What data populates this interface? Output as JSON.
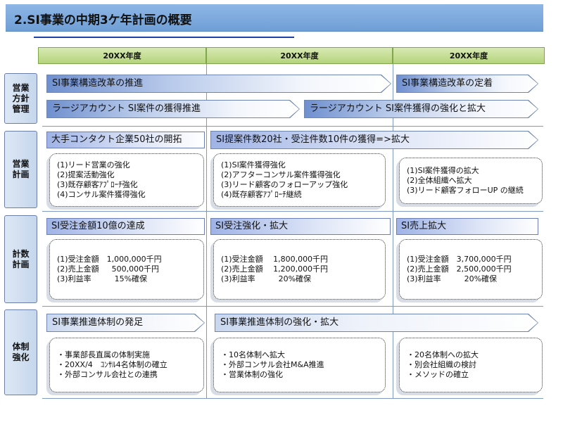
{
  "header": {
    "title": "2.SI事業の中期3ケ年計画の概要"
  },
  "columns": [
    "20XX年度",
    "20XX年度",
    "20XX年度"
  ],
  "rows": {
    "sales_policy": {
      "label": "営業\n方針\n管理",
      "arrows": [
        "SI事業構造改革の推進",
        "SI事業構造改革の定着",
        "ラージアカウント SI案件の獲得推進",
        "ラージアカウント SI案件獲得の強化と拡大"
      ]
    },
    "sales_plan": {
      "label": "営業\n計画",
      "goals": [
        "大手コンタクト企業50社の開拓",
        "SI提案件数20社・受注件数10件の獲得=>拡大"
      ],
      "boxes": [
        [
          "(1)リード営業の強化",
          "(2)提案活動強化",
          "(3)既存顧客ｱﾌﾟﾛｰﾁ強化",
          "(4)コンサル案件獲得強化"
        ],
        [
          "(1)SI案件獲得強化",
          "(2)アフターコンサル案件獲得強化",
          "(3)リード顧客のフォローアップ強化",
          "(4)既存顧客ｱﾌﾟﾛｰﾁ継続"
        ],
        [
          "(1)SI案件獲得の拡大",
          "(2)全体組織へ拡大",
          "(3)リード顧客フォローUP の継続"
        ]
      ]
    },
    "numeric_plan": {
      "label": "計数\n計画",
      "goals": [
        "SI受注金額10億の達成",
        "SI受注強化・拡大",
        "SI売上拡大"
      ],
      "boxes": [
        [
          "(1)受注金額　1,000,000千円",
          "(2)売上金額　  500,000千円",
          "(3)利益率　　　15%確保"
        ],
        [
          "(1)受注金額　 1,800,000千円",
          "(2)売上金額　 1,200,000千円",
          "(3)利益率　　　20%確保"
        ],
        [
          "(1)受注金額　3,700,000千円",
          "(2)売上金額　2,500,000千円",
          "(3)利益率　　　20%確保"
        ]
      ]
    },
    "organization": {
      "label": "体制\n強化",
      "arrows": [
        "SI事業推進体制の発足",
        "SI事業推進体制の強化・拡大"
      ],
      "boxes": [
        [
          "・事業部長直属の体制実施",
          "・20XX/4　ｺﾝｻﾙ4名体制の確立",
          "・外部コンサル会社との連携"
        ],
        [
          "・10名体制へ拡大",
          "・外部コンサル会社M&A推進",
          "・営業体制の強化"
        ],
        [
          "・20名体制への拡大",
          "・別会社組織の検討",
          "・メソッドの確立"
        ]
      ]
    }
  }
}
